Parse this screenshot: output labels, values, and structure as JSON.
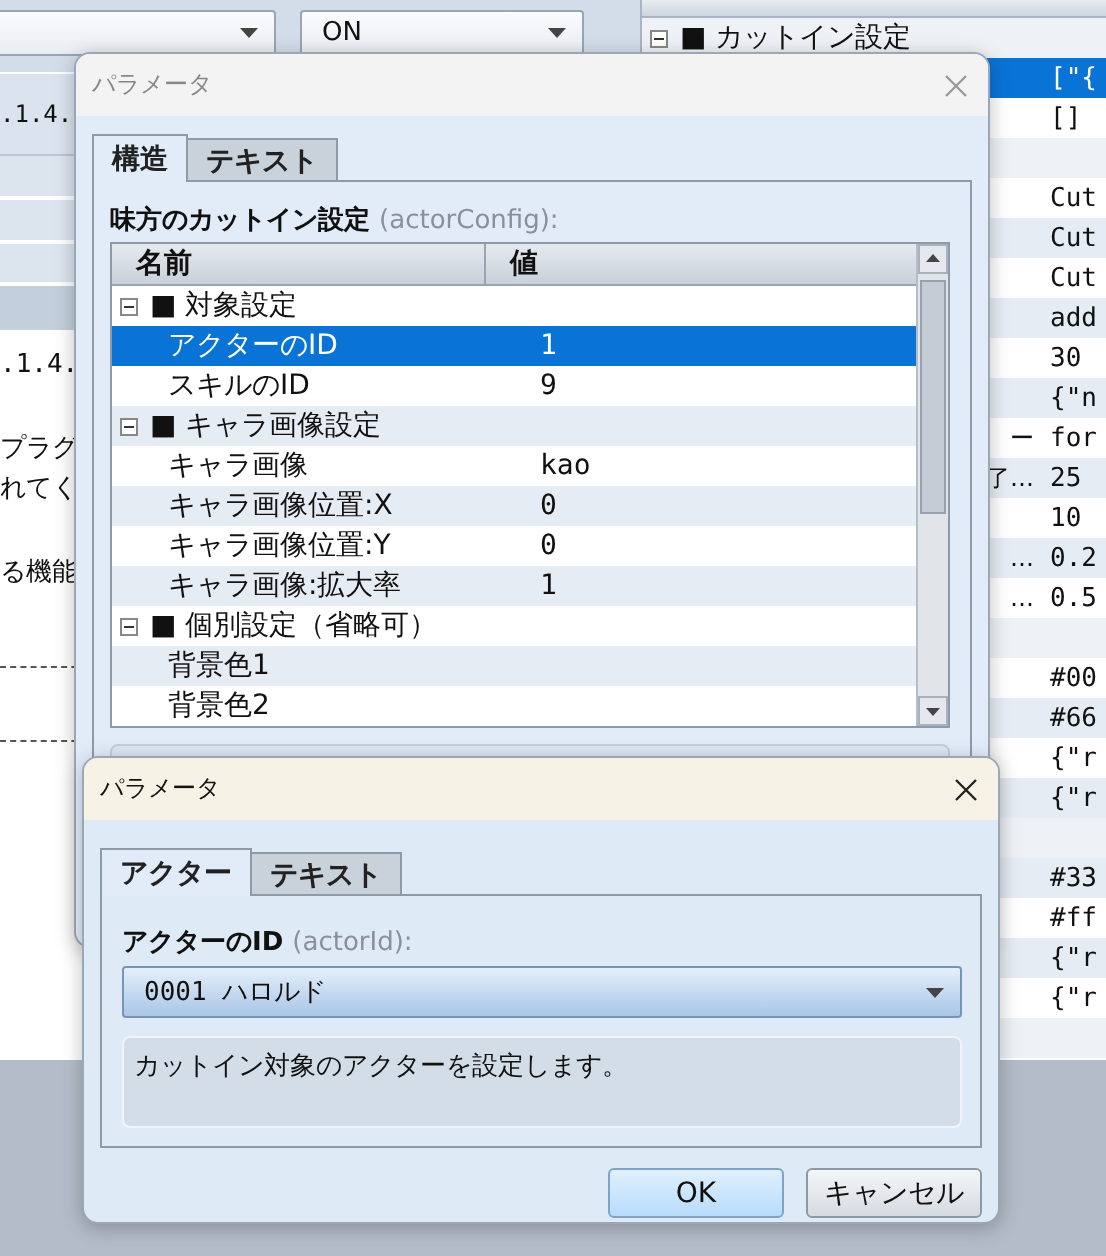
{
  "background": {
    "combo": {
      "value": "ON"
    },
    "version_text": ".1.4.",
    "paragraphs": [
      [
        ".1.4."
      ],
      [
        "プラグ",
        "れてく"
      ],
      [
        "る機能"
      ]
    ],
    "tree": {
      "rows": [
        {
          "kind": "group",
          "label": "■ カットイン設定",
          "expanded": true,
          "selected": false
        },
        {
          "kind": "item",
          "value": "[\"{",
          "selected": true
        },
        {
          "kind": "item",
          "value": "[]",
          "selected": false
        },
        {
          "kind": "group",
          "selected": false
        },
        {
          "kind": "item",
          "value": "Cut",
          "selected": false
        },
        {
          "kind": "item",
          "value": "Cut",
          "selected": false
        },
        {
          "kind": "item",
          "value": "Cut",
          "selected": false
        },
        {
          "kind": "item",
          "value": "add",
          "selected": false
        },
        {
          "kind": "item",
          "value": "30",
          "selected": false
        },
        {
          "kind": "item",
          "value": "{\"n",
          "selected": false
        },
        {
          "kind": "item",
          "name": "ー",
          "value": "for",
          "selected": false
        },
        {
          "kind": "item",
          "name": "了…",
          "value": "25",
          "selected": false
        },
        {
          "kind": "item",
          "value": "10",
          "selected": false
        },
        {
          "kind": "item",
          "name": "…",
          "value": "0.2",
          "selected": false
        },
        {
          "kind": "item",
          "name": "…",
          "value": "0.5",
          "selected": false
        },
        {
          "kind": "group",
          "selected": false
        },
        {
          "kind": "item",
          "value": "#00",
          "selected": false
        },
        {
          "kind": "item",
          "value": "#66",
          "selected": false
        },
        {
          "kind": "item",
          "value": "{\"r",
          "selected": false
        },
        {
          "kind": "item",
          "value": "{\"r",
          "selected": false
        },
        {
          "kind": "group",
          "selected": false
        },
        {
          "kind": "item",
          "value": "#33",
          "selected": false
        },
        {
          "kind": "item",
          "value": "#ff",
          "selected": false
        },
        {
          "kind": "item",
          "value": "{\"r",
          "selected": false
        },
        {
          "kind": "item",
          "value": "{\"r",
          "selected": false
        },
        {
          "kind": "group",
          "selected": false
        }
      ]
    }
  },
  "structure_dialog": {
    "title": "パラメータ",
    "tabs": [
      {
        "label": "構造",
        "selected": true
      },
      {
        "label": "テキスト",
        "selected": false
      }
    ],
    "field_label": "味方のカットイン設定",
    "field_key": "(actorConfig):",
    "columns": [
      "名前",
      "値"
    ],
    "groups": [
      {
        "label": "■ 対象設定",
        "expanded": true,
        "selected": false,
        "children": [
          {
            "name": "アクターのID",
            "value": "1",
            "selected": true
          },
          {
            "name": "スキルのID",
            "value": "9",
            "selected": false
          }
        ]
      },
      {
        "label": "■ キャラ画像設定",
        "expanded": true,
        "selected": false,
        "children": [
          {
            "name": "キャラ画像",
            "value": "kao",
            "selected": false
          },
          {
            "name": "キャラ画像位置:X",
            "value": "0",
            "selected": false
          },
          {
            "name": "キャラ画像位置:Y",
            "value": "0",
            "selected": false
          },
          {
            "name": "キャラ画像:拡大率",
            "value": "1",
            "selected": false
          }
        ]
      },
      {
        "label": "■ 個別設定（省略可）",
        "expanded": true,
        "selected": false,
        "children": [
          {
            "name": "背景色1",
            "selected": false
          },
          {
            "name": "背景色2",
            "selected": false
          }
        ]
      }
    ]
  },
  "actor_dialog": {
    "title": "パラメータ",
    "tabs": [
      {
        "label": "アクター",
        "selected": true
      },
      {
        "label": "テキスト",
        "selected": false
      }
    ],
    "field_label": "アクターのID",
    "field_key": "(actorId):",
    "select_value": "0001 ハロルド",
    "description": "カットイン対象のアクターを設定します。",
    "buttons": [
      {
        "label": "OK",
        "kind": "default"
      },
      {
        "label": "キャンセル",
        "kind": "normal"
      }
    ]
  }
}
